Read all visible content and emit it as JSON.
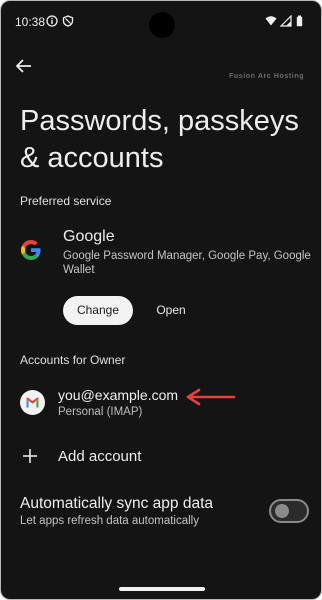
{
  "status_bar": {
    "time": "10:38"
  },
  "watermark": "Fusion Arc Hosting",
  "page": {
    "title": "Passwords, passkeys & accounts"
  },
  "preferred_service": {
    "section_label": "Preferred service",
    "name": "Google",
    "description": "Google Password Manager, Google Pay, Google Wallet",
    "change_label": "Change",
    "open_label": "Open"
  },
  "accounts": {
    "section_label": "Accounts for Owner",
    "items": [
      {
        "email": "you@example.com",
        "type": "Personal (IMAP)"
      }
    ],
    "add_label": "Add account"
  },
  "sync": {
    "title": "Automatically sync app data",
    "description": "Let apps refresh data automatically",
    "enabled": false
  },
  "colors": {
    "background": "#141414",
    "annotation_arrow": "#e8403f",
    "button_bg": "#f3f3f3"
  },
  "icons": {
    "back": "arrow-left-icon",
    "google": "google-logo-icon",
    "gmail": "gmail-icon",
    "add": "plus-icon"
  }
}
